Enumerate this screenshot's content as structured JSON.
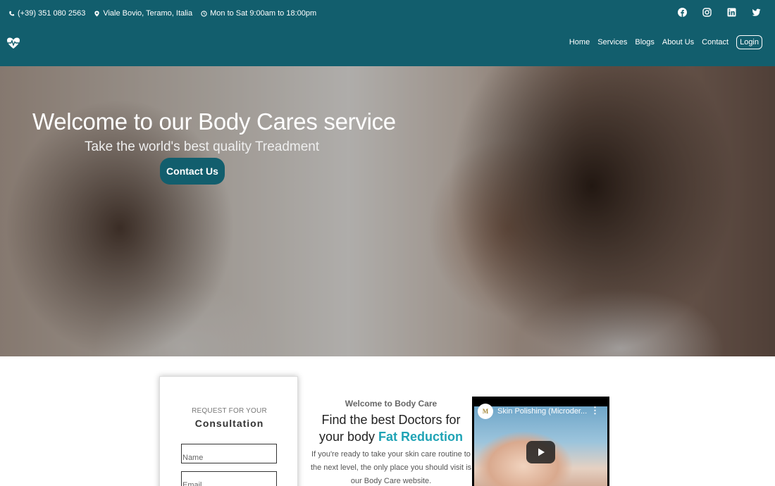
{
  "topbar": {
    "phone": "(+39) 351 080 2563",
    "address": "Viale Bovio, Teramo, Italia",
    "hours": "Mon to Sat 9:00am to 18:00pm",
    "social": [
      "facebook-icon",
      "instagram-icon",
      "linkedin-icon",
      "twitter-icon"
    ]
  },
  "nav": {
    "items": [
      {
        "label": "Home"
      },
      {
        "label": "Services"
      },
      {
        "label": "Blogs"
      },
      {
        "label": "About Us"
      },
      {
        "label": "Contact"
      }
    ],
    "login": "Login"
  },
  "hero": {
    "title": "Welcome to our Body Cares service",
    "subtitle": "Take the world's best quality Treadment",
    "cta": "Contact Us"
  },
  "consultation": {
    "pre": "REQUEST FOR YOUR",
    "title": "Consultation",
    "name_placeholder": "Name",
    "email_placeholder": "Email"
  },
  "welcome": {
    "kicker": "Welcome to Body Care",
    "heading_plain": "Find the best Doctors for your body",
    "heading_accent": "Fat Reduction",
    "body": "If you're ready to take your skin care routine to the next level, the only place you should visit is our Body Care website."
  },
  "video": {
    "title": "Skin Polishing (Microder...",
    "channel_initial": "M"
  },
  "colors": {
    "brand": "#125e6d",
    "accent": "#1fa3b5"
  }
}
